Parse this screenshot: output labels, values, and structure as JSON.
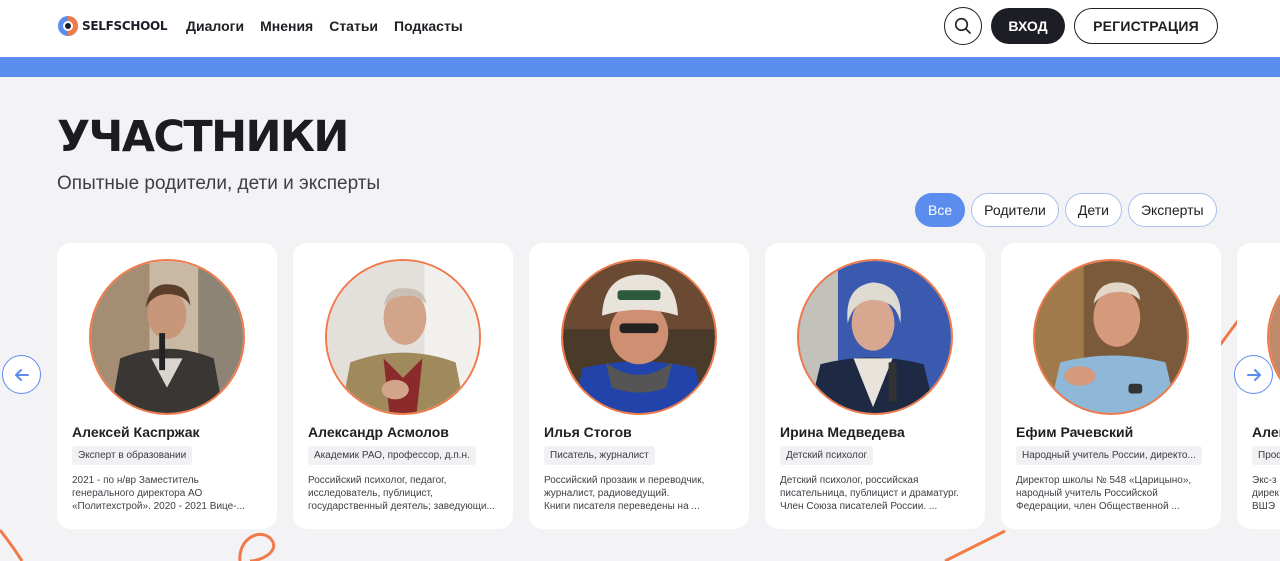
{
  "header": {
    "logo_text": "SELFSCHOOL",
    "nav": [
      "Диалоги",
      "Мнения",
      "Статьи",
      "Подкасты"
    ],
    "search_icon": "search-icon",
    "login_label": "ВХОД",
    "register_label": "РЕГИСТРАЦИЯ"
  },
  "section": {
    "title": "УЧАСТНИКИ",
    "subtitle": "Опытные родители, дети и эксперты"
  },
  "filters": [
    {
      "label": "Все",
      "active": true
    },
    {
      "label": "Родители",
      "active": false
    },
    {
      "label": "Дети",
      "active": false
    },
    {
      "label": "Эксперты",
      "active": false
    }
  ],
  "cards": [
    {
      "name": "Алексей Каспржак",
      "role": "Эксперт в образовании",
      "desc": [
        "2021 - по н/вр Заместитель",
        "генерального директора АО",
        "«Политехстрой». 2020 - 2021 Вице-..."
      ]
    },
    {
      "name": "Александр Асмолов",
      "role": "Академик РАО, профессор, д.п.н.",
      "desc": [
        "Российский психолог, педагог,",
        "исследователь, публицист,",
        "государственный деятель; заведующи..."
      ]
    },
    {
      "name": "Илья Стогов",
      "role": "Писатель, журналист",
      "desc": [
        "Российский прозаик и переводчик,",
        "журналист, радиоведущий.",
        "Книги писателя переведены на ..."
      ]
    },
    {
      "name": "Ирина Медведева",
      "role": "Детский психолог",
      "desc": [
        "Детский психолог, российская",
        "писательница, публицист и драматург.",
        "Член Союза писателей России. ..."
      ]
    },
    {
      "name": "Ефим Рачевский",
      "role": "Народный учитель России, директо...",
      "desc": [
        "Директор школы № 548 «Царицыно»,",
        "народный учитель Российской",
        "Федерации, член Общественной ..."
      ]
    },
    {
      "name": "Алек",
      "role": "Проф",
      "desc": [
        "Экс-з",
        "дирек",
        "ВШЭ"
      ]
    }
  ],
  "colors": {
    "accent_blue": "#5b8def",
    "accent_orange": "#f07a4a",
    "dark": "#1d1e25"
  },
  "icons": {
    "arrow_left": "arrow-left-icon",
    "arrow_right": "arrow-right-icon"
  }
}
